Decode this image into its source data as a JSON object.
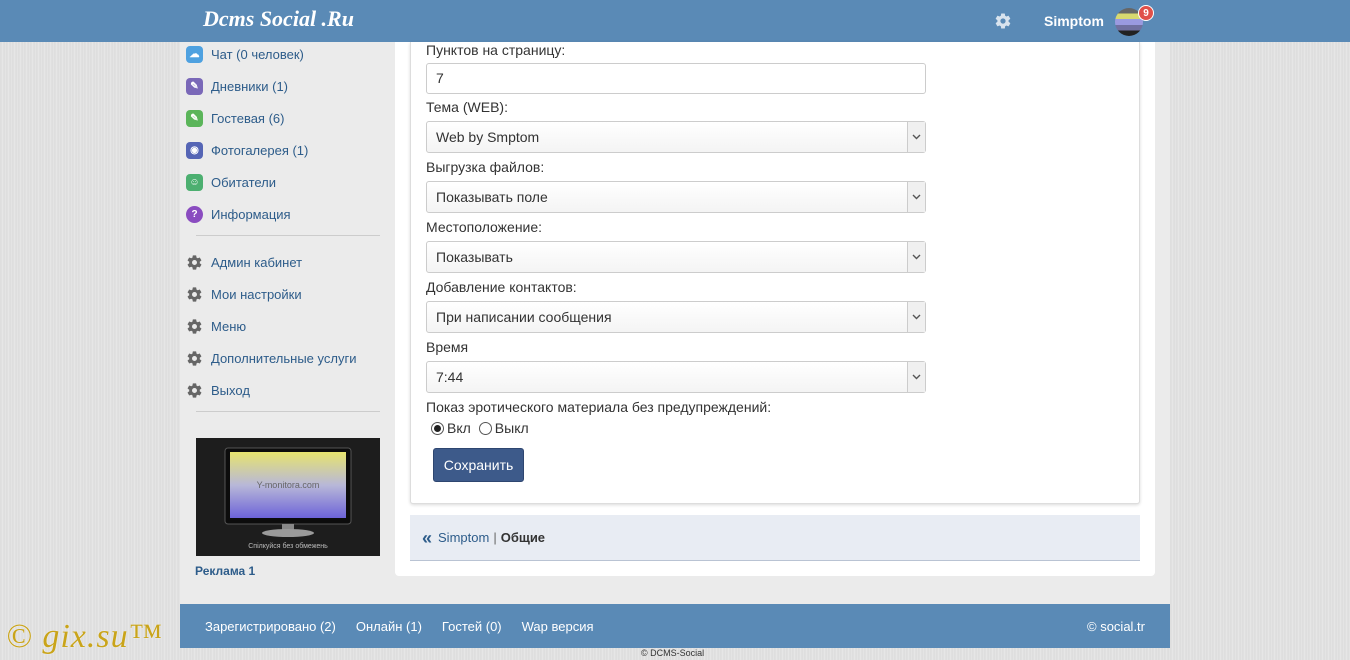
{
  "header": {
    "logo": "Dcms Social .Ru",
    "username": "Simptom",
    "notification_count": "9"
  },
  "sidebar": {
    "items": [
      {
        "label": "Чат (0 человек)",
        "icon": "chat-icon",
        "color": "#4ea1e0",
        "glyph": "☁"
      },
      {
        "label": "Дневники (1)",
        "icon": "diary-icon",
        "color": "#7a68b8",
        "glyph": "✎"
      },
      {
        "label": "Гостевая (6)",
        "icon": "guestbook-icon",
        "color": "#5bb55a",
        "glyph": "✎"
      },
      {
        "label": "Фотогалерея (1)",
        "icon": "camera-icon",
        "color": "#5565b5",
        "glyph": "◉"
      },
      {
        "label": "Обитатели",
        "icon": "users-icon",
        "color": "#4caf70",
        "glyph": "☺"
      },
      {
        "label": "Информация",
        "icon": "help-icon",
        "color": "#8a4cc0",
        "glyph": "?"
      }
    ],
    "admin_items": [
      {
        "label": "Админ кабинет"
      },
      {
        "label": "Мои настройки"
      },
      {
        "label": "Меню"
      },
      {
        "label": "Дополнительные услуги"
      },
      {
        "label": "Выход"
      }
    ],
    "ad": {
      "site_text": "Y-monitora.com",
      "tagline": "Спілкуйся без обмежень",
      "label": "Реклама 1"
    }
  },
  "form": {
    "per_page_label": "Пунктов на страницу:",
    "per_page_value": "7",
    "theme_label": "Тема (WEB):",
    "theme_value": "Web by Smptom",
    "upload_label": "Выгрузка файлов:",
    "upload_value": "Показывать поле",
    "location_label": "Местоположение:",
    "location_value": "Показывать",
    "contacts_label": "Добавление контактов:",
    "contacts_value": "При написании сообщения",
    "time_label": "Время",
    "time_value": "7:44",
    "erotic_label": "Показ эротического материала без предупреждений:",
    "radio_on": "Вкл",
    "radio_off": "Выкл",
    "radio_selected": "on",
    "save_label": "Сохранить"
  },
  "breadcrumb": {
    "back": "«",
    "link": "Simptom",
    "separator": "|",
    "current": "Общие"
  },
  "footer": {
    "registered": "Зарегистрировано (2)",
    "online": "Онлайн (1)",
    "guests": "Гостей (0)",
    "wap": "Wap версия",
    "copyright": "© social.tr",
    "bottom_note": "© DCMS-Social"
  },
  "watermark": "© gix.su™",
  "colors": {
    "header_bg": "#5a8ab6",
    "link": "#2d5c8a",
    "button": "#3d5a8a",
    "badge": "#e0504a"
  }
}
